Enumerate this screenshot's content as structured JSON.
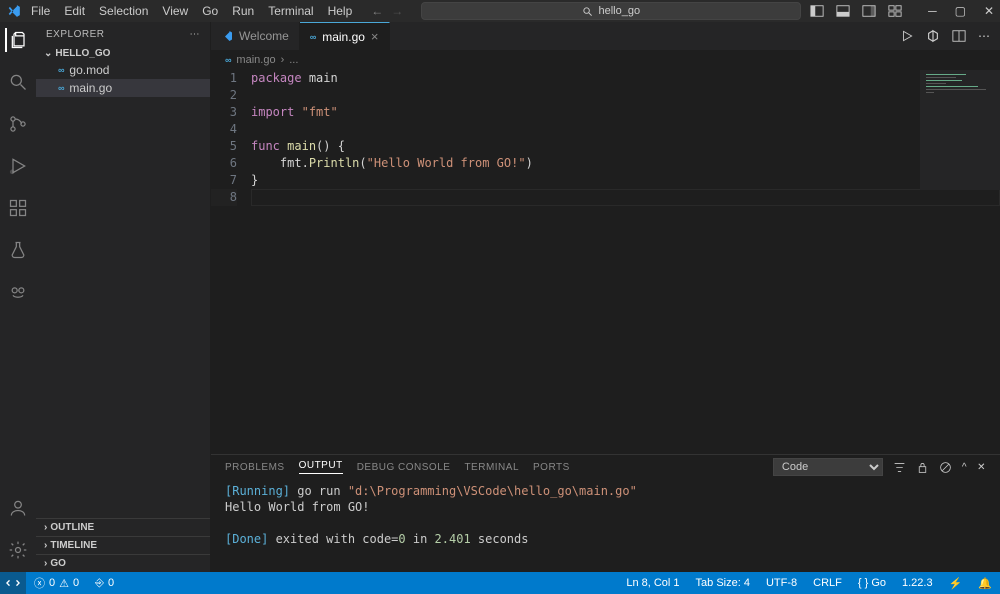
{
  "menu": [
    "File",
    "Edit",
    "Selection",
    "View",
    "Go",
    "Run",
    "Terminal",
    "Help"
  ],
  "search_placeholder": "hello_go",
  "explorer": {
    "title": "EXPLORER",
    "root": "HELLO_GO",
    "files": [
      {
        "name": "go.mod",
        "icon": "go"
      },
      {
        "name": "main.go",
        "icon": "go",
        "selected": true
      }
    ],
    "sections": [
      "OUTLINE",
      "TIMELINE",
      "GO"
    ]
  },
  "tabs": [
    {
      "label": "Welcome",
      "active": false,
      "icon": "vscode"
    },
    {
      "label": "main.go",
      "active": true,
      "icon": "go",
      "closable": true
    }
  ],
  "breadcrumb": [
    "main.go",
    "..."
  ],
  "code": {
    "lines": [
      {
        "n": 1,
        "tokens": [
          [
            "kw",
            "package"
          ],
          [
            "sp",
            " "
          ],
          [
            "ident",
            "main"
          ]
        ]
      },
      {
        "n": 2,
        "tokens": []
      },
      {
        "n": 3,
        "tokens": [
          [
            "kw",
            "import"
          ],
          [
            "sp",
            " "
          ],
          [
            "str",
            "\"fmt\""
          ]
        ]
      },
      {
        "n": 4,
        "tokens": []
      },
      {
        "n": 5,
        "tokens": [
          [
            "kw",
            "func"
          ],
          [
            "sp",
            " "
          ],
          [
            "func-name",
            "main"
          ],
          [
            "punc",
            "() {"
          ]
        ]
      },
      {
        "n": 6,
        "tokens": [
          [
            "sp",
            "    "
          ],
          [
            "ident",
            "fmt"
          ],
          [
            "punc",
            "."
          ],
          [
            "func-name",
            "Println"
          ],
          [
            "punc",
            "("
          ],
          [
            "str",
            "\"Hello World from GO!\""
          ],
          [
            "punc",
            ")"
          ]
        ]
      },
      {
        "n": 7,
        "tokens": [
          [
            "punc",
            "}"
          ]
        ]
      },
      {
        "n": 8,
        "tokens": [],
        "current": true
      }
    ]
  },
  "panel": {
    "tabs": [
      "PROBLEMS",
      "OUTPUT",
      "DEBUG CONSOLE",
      "TERMINAL",
      "PORTS"
    ],
    "active": "OUTPUT",
    "selector": "Code",
    "output": [
      {
        "segments": [
          [
            "out-info",
            "[Running]"
          ],
          [
            "plain",
            " go run "
          ],
          [
            "out-str",
            "\"d:\\Programming\\VSCode\\hello_go\\main.go\""
          ]
        ]
      },
      {
        "segments": [
          [
            "plain",
            "Hello World from GO!"
          ]
        ]
      },
      {
        "segments": []
      },
      {
        "segments": [
          [
            "out-done",
            "[Done]"
          ],
          [
            "plain",
            " exited with "
          ],
          [
            "plain",
            "code="
          ],
          [
            "out-num",
            "0"
          ],
          [
            "plain",
            " in "
          ],
          [
            "out-num",
            "2.401"
          ],
          [
            "plain",
            " seconds"
          ]
        ]
      }
    ]
  },
  "status": {
    "left_errors": "0",
    "left_warnings": "0",
    "left_ports": "0",
    "right": [
      "Ln 8, Col 1",
      "Tab Size: 4",
      "UTF-8",
      "CRLF",
      "{ } Go",
      "1.22.3",
      "⚡"
    ],
    "notification_icon": "bell"
  }
}
